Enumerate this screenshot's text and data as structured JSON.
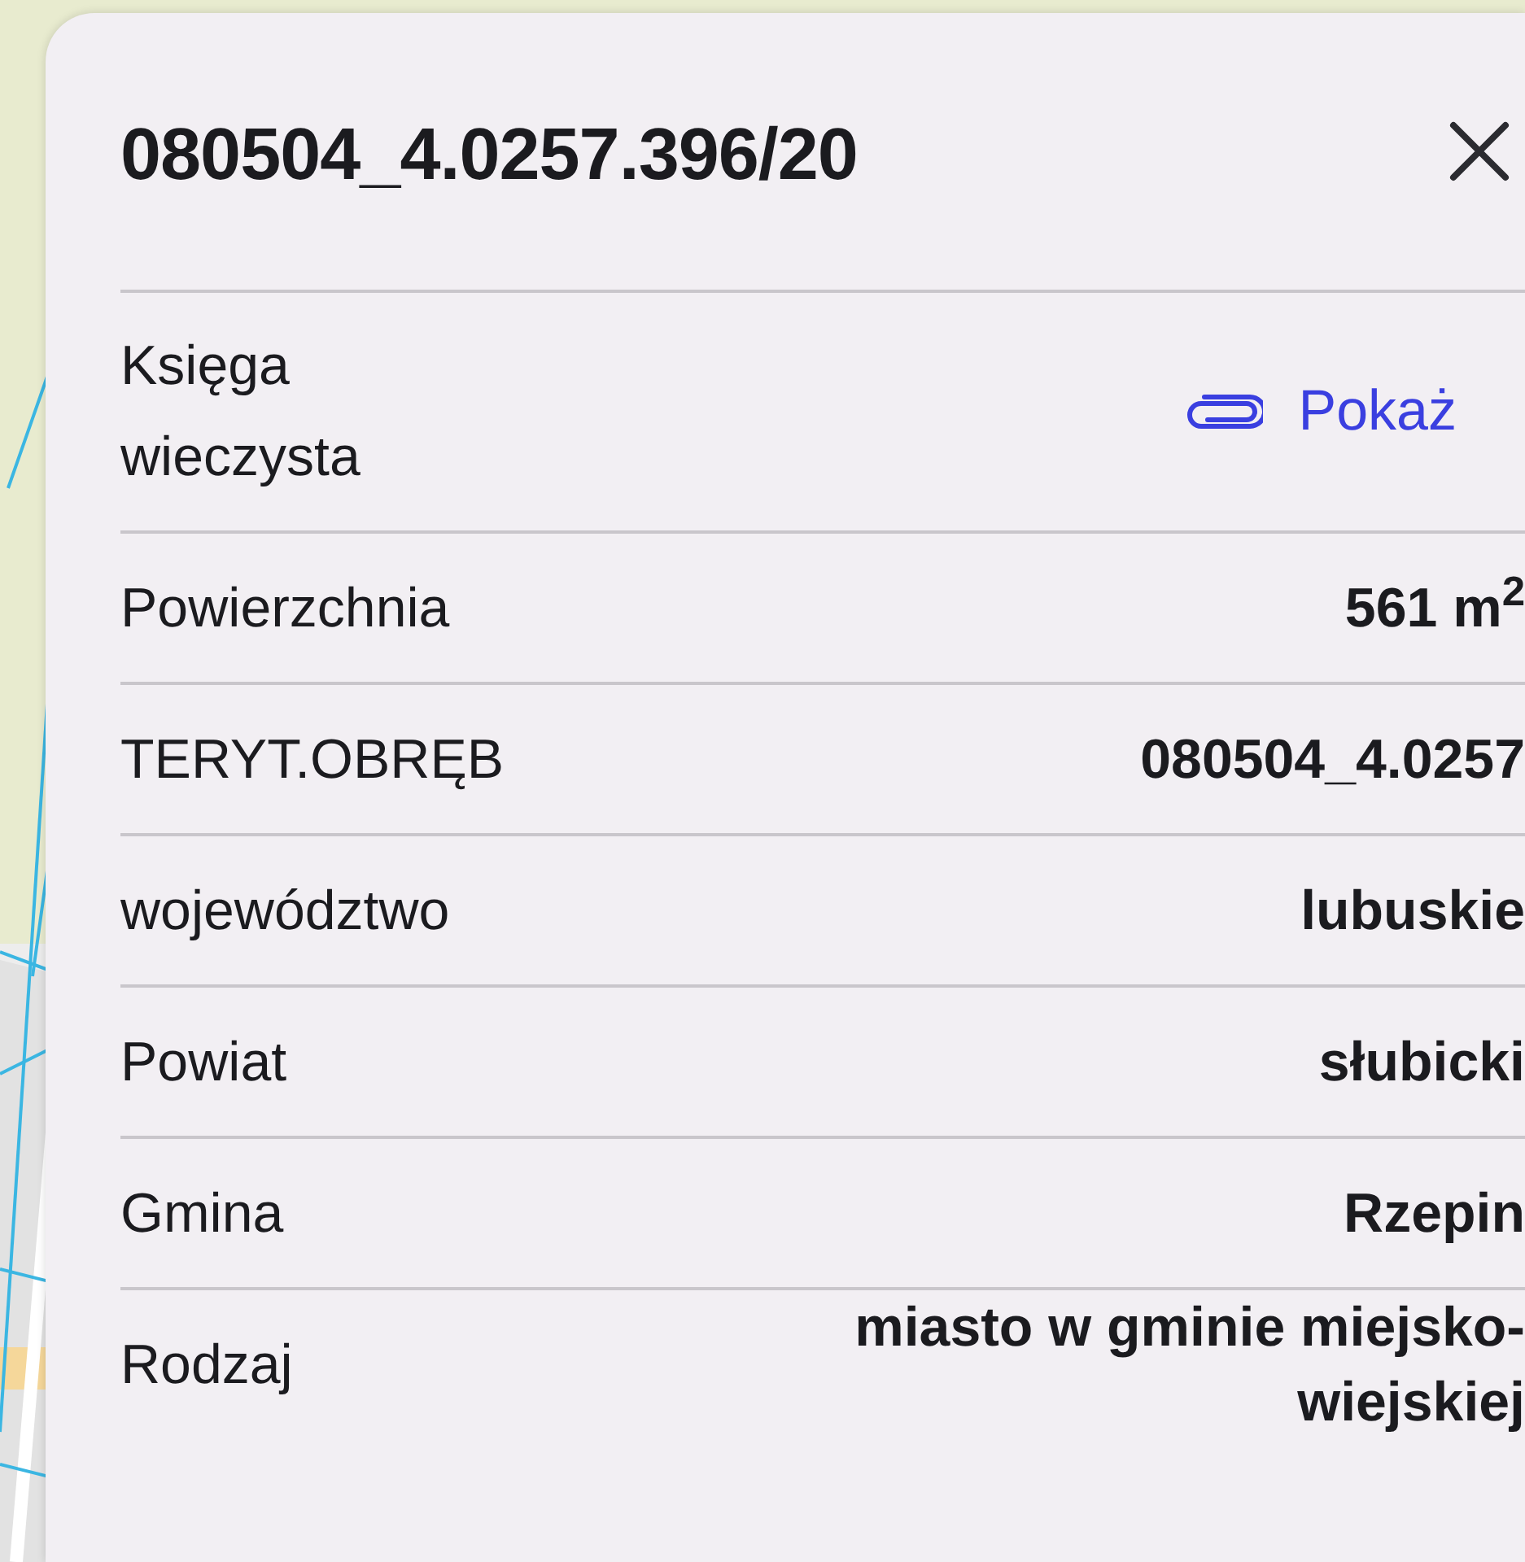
{
  "panel": {
    "title": "080504_4.0257.396/20",
    "rows": [
      {
        "kind": "link",
        "label_lines": [
          "Księga",
          "wieczysta"
        ],
        "value_lines": [
          "Pokaż"
        ]
      },
      {
        "kind": "value",
        "label_lines": [
          "Powierzchnia"
        ],
        "value_lines": [
          "561 m$^{2}$"
        ]
      },
      {
        "kind": "value",
        "label_lines": [
          "TERYT.OBRĘB"
        ],
        "value_lines": [
          "080504_4.0257"
        ]
      },
      {
        "kind": "value",
        "label_lines": [
          "województwo"
        ],
        "value_lines": [
          "lubuskie"
        ]
      },
      {
        "kind": "value",
        "label_lines": [
          "Powiat"
        ],
        "value_lines": [
          "słubicki"
        ]
      },
      {
        "kind": "value",
        "label_lines": [
          "Gmina"
        ],
        "value_lines": [
          "Rzepin"
        ]
      },
      {
        "kind": "value",
        "label_lines": [
          "Rodzaj"
        ],
        "value_lines": [
          "miasto w gminie miejsko-",
          "wiejskiej"
        ]
      }
    ]
  }
}
